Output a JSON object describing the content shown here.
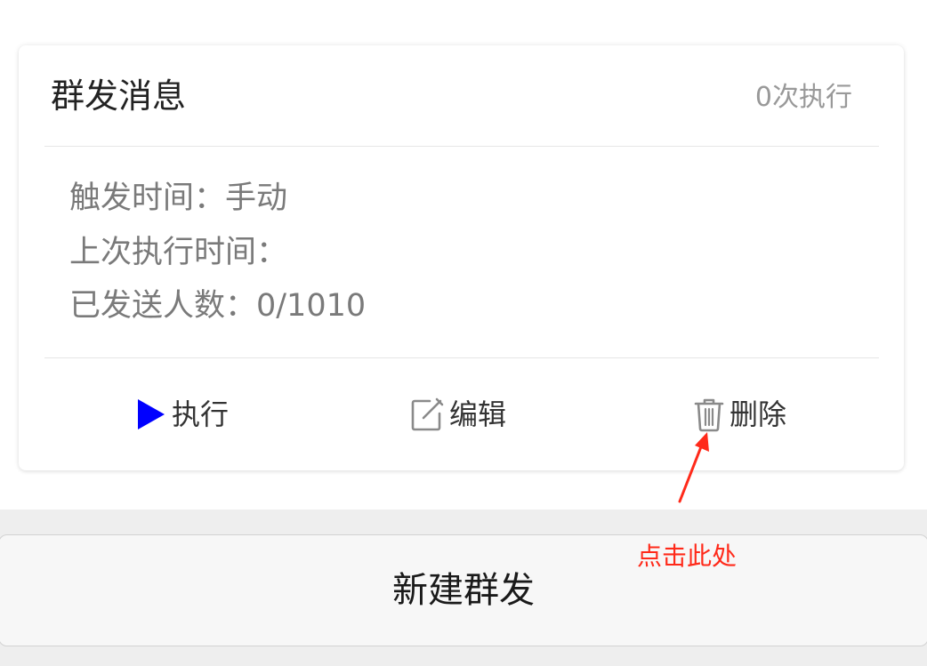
{
  "card": {
    "title": "群发消息",
    "exec_count": "0次执行",
    "trigger_time": "触发时间：手动",
    "last_exec_time": "上次执行时间：",
    "sent_count": "已发送人数：0/1010"
  },
  "actions": {
    "execute": {
      "label": "执行",
      "icon": "play-icon",
      "icon_color": "#0000ff"
    },
    "edit": {
      "label": "编辑",
      "icon": "edit-icon"
    },
    "delete": {
      "label": "删除",
      "icon": "trash-icon"
    }
  },
  "new_broadcast_button": "新建群发",
  "annotation": {
    "text": "点击此处",
    "color": "#ff2a1a"
  }
}
